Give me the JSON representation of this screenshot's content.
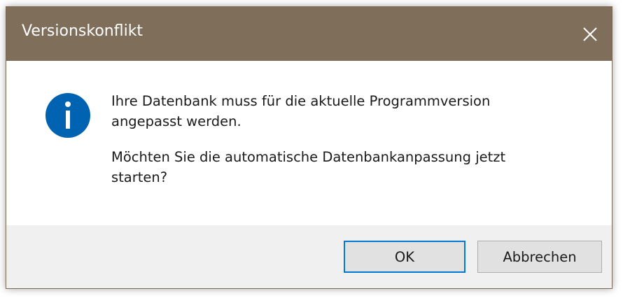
{
  "window": {
    "title": "Versionskonflikt",
    "titlebar_color": "#7f6e5a",
    "close_icon": "close-icon"
  },
  "message": {
    "icon": "info-icon",
    "icon_color": "#0063b1",
    "line1": "Ihre Datenbank muss für die aktuelle Programmversion\nangepasst werden.",
    "line2": "Möchten Sie die automatische Datenbankanpassung jetzt\nstarten?"
  },
  "buttons": {
    "ok_label": "OK",
    "cancel_label": "Abbrechen",
    "focus_color": "#0078d7"
  }
}
